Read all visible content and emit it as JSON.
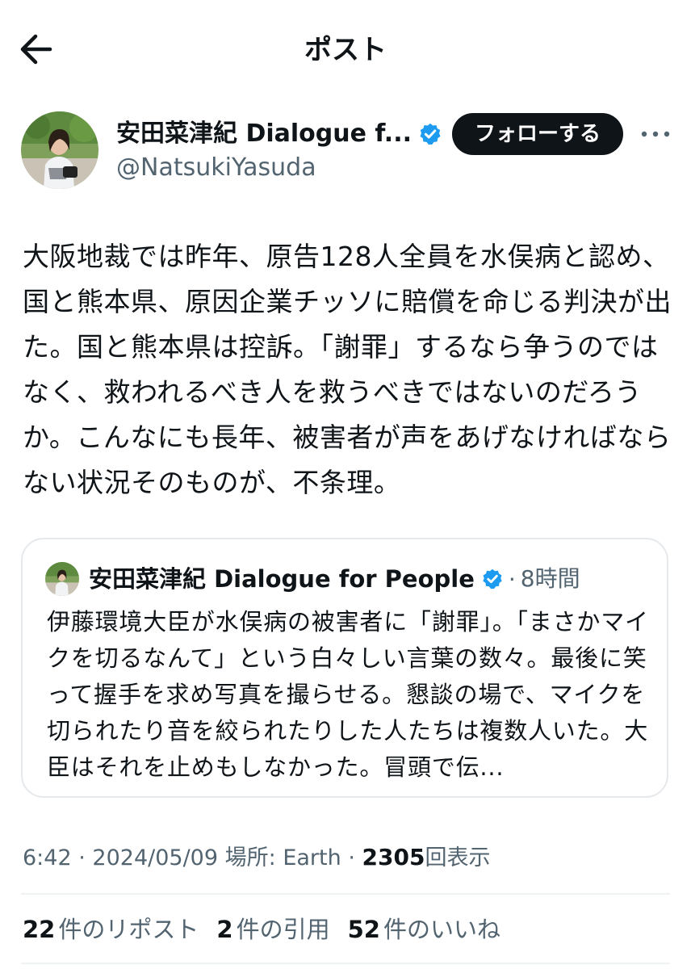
{
  "header": {
    "title": "ポスト"
  },
  "author": {
    "display_name": "安田菜津紀 Dialogue f...",
    "handle": "@NatsukiYasuda",
    "follow_label": "フォローする"
  },
  "tweet": {
    "text": "大阪地裁では昨年、原告128人全員を水俣病と認め、国と熊本県、原因企業チッソに賠償を命じる判決が出た。国と熊本県は控訴。「謝罪」するなら争うのではなく、救われるべき人を救うべきではないのだろうか。こんなにも長年、被害者が声をあげなければならない状況そのものが、不条理。"
  },
  "quote": {
    "display_name": "安田菜津紀 Dialogue for People",
    "separator": "·",
    "time": "8時間",
    "text": "伊藤環境大臣が水俣病の被害者に「謝罪」。「まさかマイクを切るなんて」という白々しい言葉の数々。最後に笑って握手を求め写真を撮らせる。懇談の場で、マイクを切られたり音を絞られたりした人たちは複数人いた。大臣はそれを止めもしなかった。冒頭で伝..."
  },
  "meta": {
    "time": "6:42",
    "sep1": "·",
    "date": "2024/05/09",
    "location": "場所: Earth",
    "sep2": "·",
    "views_count": "2305",
    "views_label": "回表示"
  },
  "stats": {
    "reposts_count": "22",
    "reposts_label": "件のリポスト",
    "quotes_count": "2",
    "quotes_label": "件の引用",
    "likes_count": "52",
    "likes_label": "件のいいね"
  },
  "colors": {
    "verified": "#1d9bf0",
    "muted": "#536471",
    "follow_bg": "#0f1419"
  }
}
